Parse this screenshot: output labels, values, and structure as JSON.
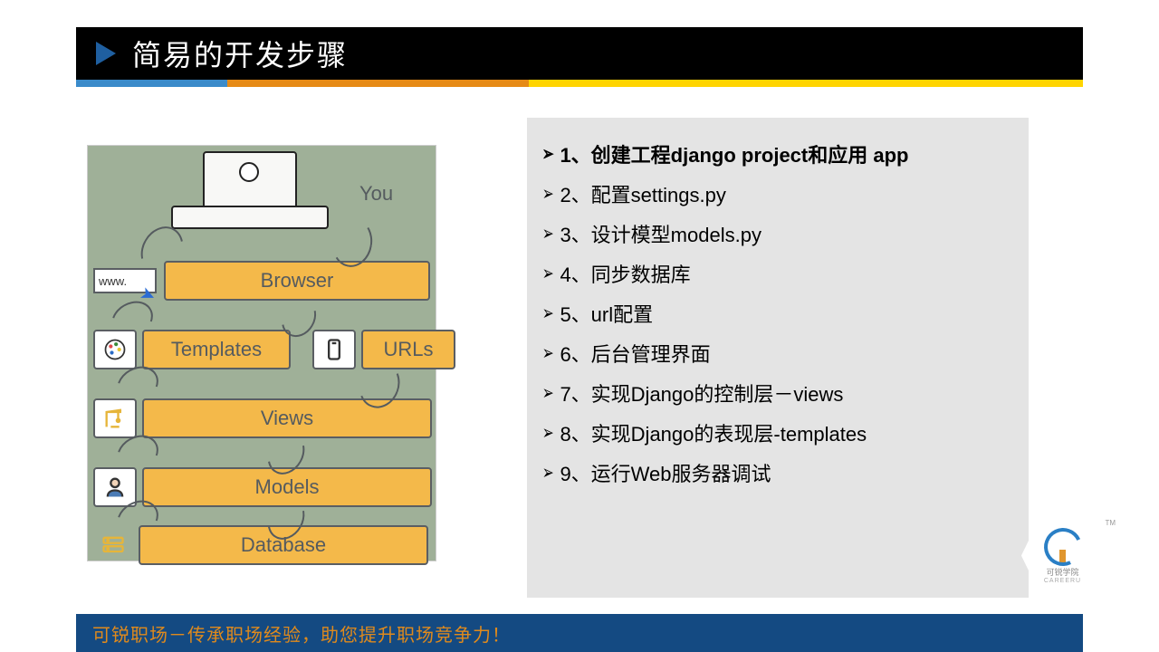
{
  "title": "简易的开发步骤",
  "diagram": {
    "you": "You",
    "www": "www.",
    "browser": "Browser",
    "templates": "Templates",
    "urls": "URLs",
    "views": "Views",
    "models": "Models",
    "database": "Database"
  },
  "steps": [
    "1、创建工程django project和应用 app",
    "2、配置settings.py",
    "3、设计模型models.py",
    "4、同步数据库",
    "5、url配置",
    "6、后台管理界面",
    "7、实现Django的控制层－views",
    "8、实现Django的表现层-templates",
    "9、运行Web服务器调试"
  ],
  "footer": "可锐职场－传承职场经验，助您提升职场竞争力！",
  "logo": {
    "cn": "可锐学院",
    "en": "CAREERU",
    "tm": "TM"
  }
}
